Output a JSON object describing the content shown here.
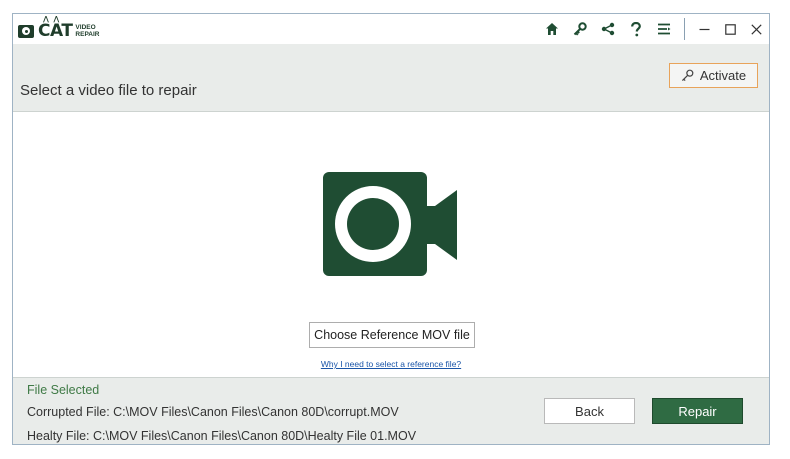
{
  "app": {
    "logo_text": "CAT",
    "logo_sub_1": "VIDEO",
    "logo_sub_2": "REPAIR"
  },
  "titlebar": {
    "icons": [
      "home-icon",
      "key-icon",
      "share-icon",
      "help-icon",
      "menu-icon"
    ],
    "window_controls": [
      "minimize-icon",
      "maximize-icon",
      "close-icon"
    ]
  },
  "header": {
    "title": "Select a video file to repair",
    "activate_label": "Activate"
  },
  "main": {
    "ref_button_label": "Choose Reference MOV file",
    "ref_link": "Why I need to select a reference file?"
  },
  "footer": {
    "file_selected_label": "File Selected",
    "corrupted_file": "Corrupted File: C:\\MOV Files\\Canon Files\\Canon 80D\\corrupt.MOV",
    "healthy_file": "Healty File: C:\\MOV Files\\Canon Files\\Canon 80D\\Healty File 01.MOV",
    "back_label": "Back",
    "repair_label": "Repair"
  },
  "colors": {
    "brand_green": "#1f4d33",
    "accent_orange": "#e8a35a",
    "link_blue": "#1a55a8"
  }
}
